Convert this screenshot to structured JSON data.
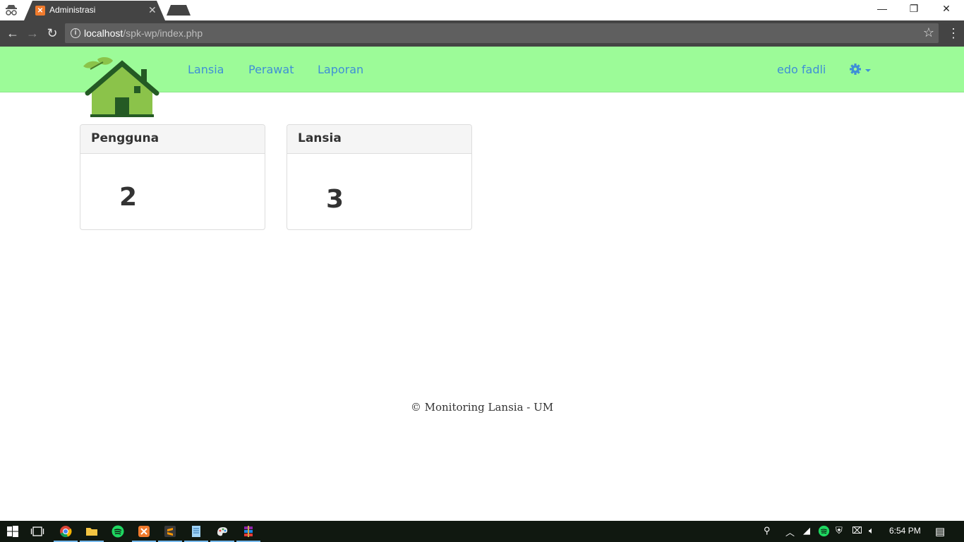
{
  "browser": {
    "tab_title": "Administrasi",
    "url_host": "localhost",
    "url_path": "/spk-wp/index.php"
  },
  "navbar": {
    "links": [
      "Lansia",
      "Perawat",
      "Laporan"
    ],
    "user_name": "edo fadli"
  },
  "panels": [
    {
      "title": "Pengguna",
      "value": "2"
    },
    {
      "title": "Lansia",
      "value": "3"
    }
  ],
  "footer": {
    "text": "© Monitoring Lansia - UM"
  },
  "taskbar": {
    "time": "6:54 PM"
  },
  "colors": {
    "navbar_bg": "#9cfb98",
    "link": "#3f8fd6",
    "chrome": "#444444"
  }
}
